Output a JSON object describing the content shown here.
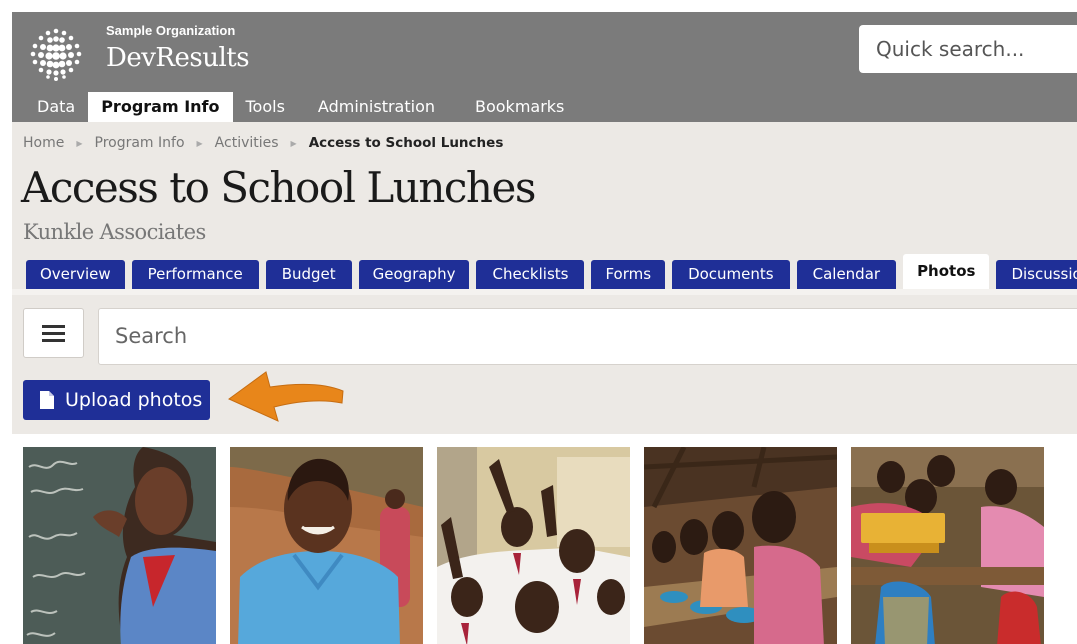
{
  "header": {
    "org_name": "Sample Organization",
    "app_name": "DevResults",
    "quick_search_placeholder": "Quick search..."
  },
  "main_nav": [
    {
      "label": "Data",
      "active": false
    },
    {
      "label": "Program Info",
      "active": true
    },
    {
      "label": "Tools",
      "active": false
    },
    {
      "label": "Administration",
      "active": false
    },
    {
      "label": "Bookmarks",
      "active": false
    }
  ],
  "breadcrumb": [
    "Home",
    "Program Info",
    "Activities",
    "Access to School Lunches"
  ],
  "page": {
    "title": "Access to School Lunches",
    "subtitle": "Kunkle Associates"
  },
  "tabs": [
    {
      "label": "Overview",
      "active": false
    },
    {
      "label": "Performance",
      "active": false
    },
    {
      "label": "Budget",
      "active": false
    },
    {
      "label": "Geography",
      "active": false
    },
    {
      "label": "Checklists",
      "active": false
    },
    {
      "label": "Forms",
      "active": false
    },
    {
      "label": "Documents",
      "active": false
    },
    {
      "label": "Calendar",
      "active": false
    },
    {
      "label": "Photos",
      "active": true
    },
    {
      "label": "Discussion",
      "active": false
    }
  ],
  "search": {
    "placeholder": "Search"
  },
  "upload_button": {
    "label": "Upload photos",
    "icon": "document-icon"
  },
  "annotation": {
    "icon": "orange-arrow",
    "color": "#e8861a"
  },
  "photos": [
    {
      "subject": "child-writing-on-chalkboard"
    },
    {
      "subject": "smiling-girl-in-blue-uniform"
    },
    {
      "subject": "students-raising-hands"
    },
    {
      "subject": "students-eating-lunch"
    },
    {
      "subject": "students-at-desks"
    }
  ],
  "colors": {
    "header_bg": "#7b7b7b",
    "page_bg": "#ece9e5",
    "tab_blue": "#1f2f97",
    "accent_orange": "#e8861a"
  }
}
